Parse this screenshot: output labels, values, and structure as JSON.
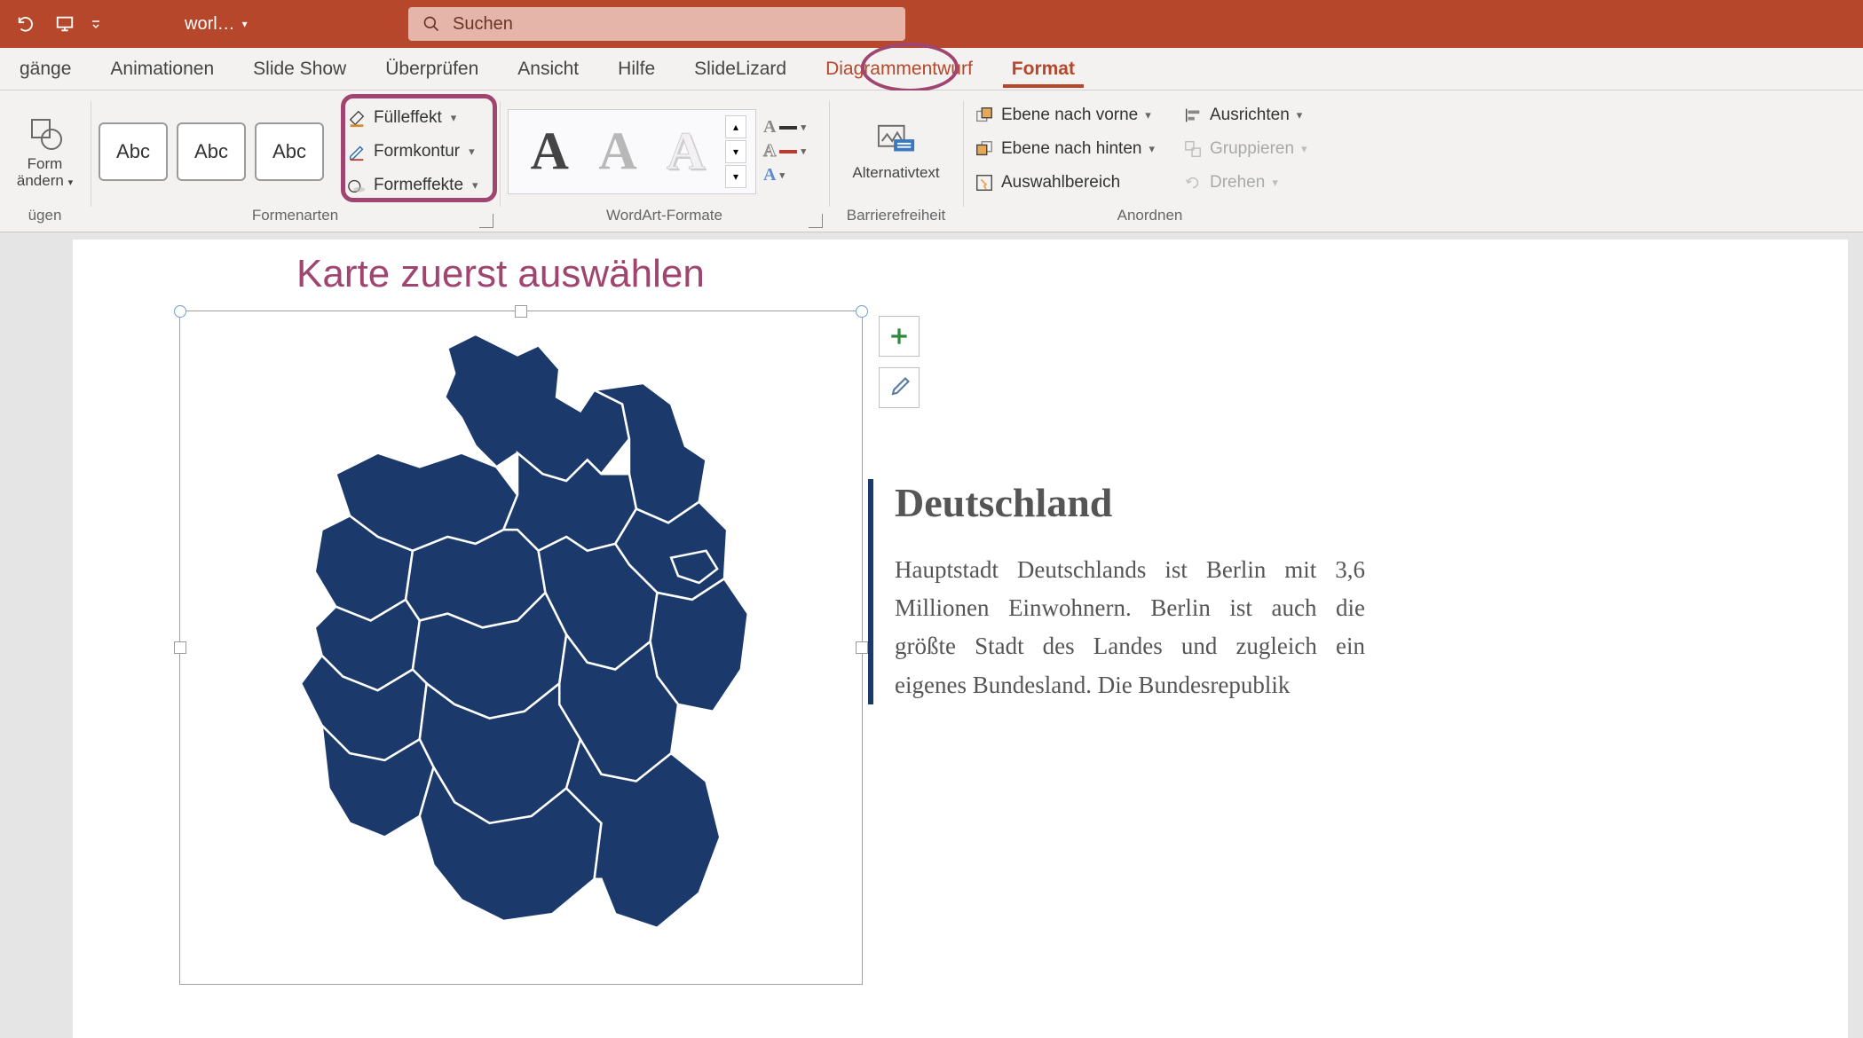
{
  "titlebar": {
    "doc_name": "worl…"
  },
  "search": {
    "placeholder": "Suchen"
  },
  "tabs": {
    "list": [
      {
        "label": "gänge"
      },
      {
        "label": "Animationen"
      },
      {
        "label": "Slide Show"
      },
      {
        "label": "Überprüfen"
      },
      {
        "label": "Ansicht"
      },
      {
        "label": "Hilfe"
      },
      {
        "label": "SlideLizard"
      },
      {
        "label": "Diagrammentwurf"
      },
      {
        "label": "Format"
      }
    ]
  },
  "ribbon": {
    "change_shape": "Form ändern",
    "insert_suffix": "ügen",
    "gallery_abc": "Abc",
    "shape_fill": "Fülleffekt",
    "shape_outline": "Formkontur",
    "shape_effects": "Formeffekte",
    "group_shapestyles": "Formenarten",
    "group_wordart": "WordArt-Formate",
    "alt_text": "Alternativtext",
    "group_access": "Barrierefreiheit",
    "bring_forward": "Ebene nach vorne",
    "send_backward": "Ebene nach hinten",
    "selection_pane": "Auswahlbereich",
    "align": "Ausrichten",
    "group_objs": "Gruppieren",
    "rotate": "Drehen",
    "group_arrange": "Anordnen"
  },
  "slide": {
    "annotation": "Karte zuerst auswählen",
    "heading": "Deutschland",
    "paragraph": "Hauptstadt Deutschlands ist Berlin mit 3,6 Millionen Einwohnern. Berlin ist auch die größte Stadt des Landes und zugleich ein eigenes Bundesland. Die Bundesrepublik"
  }
}
